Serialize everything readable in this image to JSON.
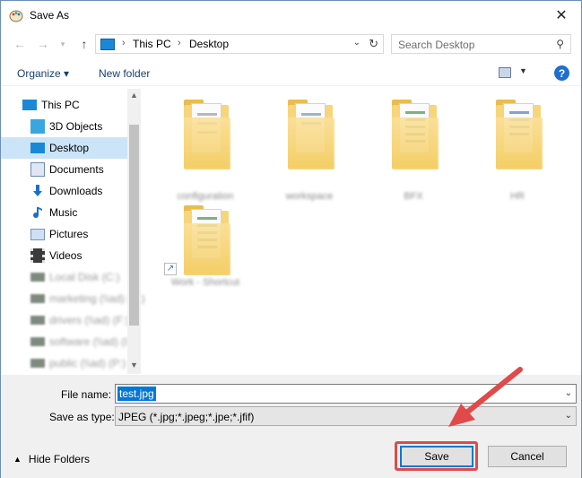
{
  "window": {
    "title": "Save As"
  },
  "nav": {
    "breadcrumb": [
      "This PC",
      "Desktop"
    ],
    "search_placeholder": "Search Desktop"
  },
  "toolbar": {
    "organize": "Organize ▾",
    "new_folder": "New folder",
    "help": "?"
  },
  "sidebar": {
    "items": [
      {
        "label": "This PC",
        "icon": "computer-icon",
        "color": "#1b88d6"
      },
      {
        "label": "3D Objects",
        "icon": "cube-icon",
        "color": "#3aa6e0"
      },
      {
        "label": "Desktop",
        "icon": "desktop-icon",
        "color": "#1b88d6"
      },
      {
        "label": "Documents",
        "icon": "document-icon",
        "color": "#6b8bb3"
      },
      {
        "label": "Downloads",
        "icon": "download-icon",
        "color": "#1b6fc9"
      },
      {
        "label": "Music",
        "icon": "music-icon",
        "color": "#1b6fc9"
      },
      {
        "label": "Pictures",
        "icon": "pictures-icon",
        "color": "#6f94c4"
      },
      {
        "label": "Videos",
        "icon": "video-icon",
        "color": "#5a5a5a"
      },
      {
        "label": "Local Disk (C:)",
        "icon": "drive-icon",
        "color": "#7f8a7f"
      },
      {
        "label": "marketing (\\\\ad) (E:)",
        "icon": "network-drive-icon",
        "color": "#7f8a7f"
      },
      {
        "label": "drivers (\\\\ad) (F:)",
        "icon": "network-drive-icon",
        "color": "#7f8a7f"
      },
      {
        "label": "software (\\\\ad) (I:)",
        "icon": "network-drive-icon",
        "color": "#7f8a7f"
      },
      {
        "label": "public (\\\\ad) (P:)",
        "icon": "network-drive-icon",
        "color": "#7f8a7f"
      }
    ]
  },
  "content": {
    "folders": [
      {
        "name": "configuration"
      },
      {
        "name": "workspace"
      },
      {
        "name": "BFX"
      },
      {
        "name": "HR"
      },
      {
        "name": "Work - Shortcut"
      }
    ]
  },
  "footer": {
    "file_name_label": "File name:",
    "file_name_value": "test.jpg",
    "save_type_label": "Save as type:",
    "save_type_value": "JPEG (*.jpg;*.jpeg;*.jpe;*.jfif)",
    "hide_folders": "Hide Folders",
    "save": "Save",
    "cancel": "Cancel"
  },
  "annotation": {
    "arrow_color": "#e04a4a"
  }
}
